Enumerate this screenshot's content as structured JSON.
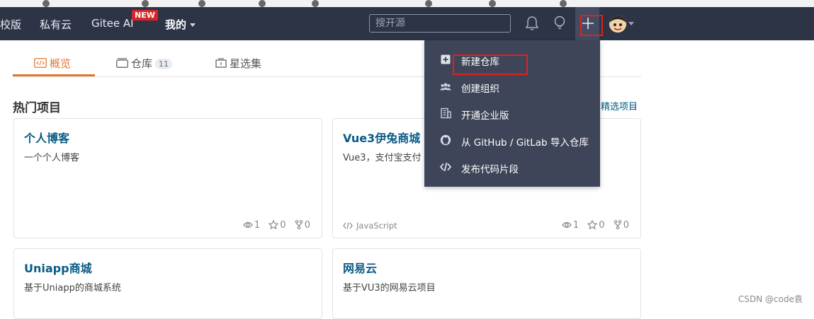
{
  "nav": {
    "items": [
      "校版",
      "私有云",
      "Gitee AI"
    ],
    "new_badge": "NEW",
    "mine": "我的",
    "search_placeholder": "搜开源"
  },
  "tabs": [
    {
      "label": "概览",
      "active": true
    },
    {
      "label": "仓库",
      "count": "11"
    },
    {
      "label": "星选集"
    }
  ],
  "section": {
    "title": "热门项目",
    "link": "精选项目"
  },
  "cards": [
    {
      "title": "个人博客",
      "desc": "一个个人博客",
      "lang": "",
      "watch": "1",
      "star": "0",
      "fork": "0"
    },
    {
      "title": "Vue3伊兔商城（",
      "desc": "Vue3，支付宝支付",
      "lang": "JavaScript",
      "watch": "1",
      "star": "0",
      "fork": "0"
    },
    {
      "title": "Uniapp商城",
      "desc": "基于Uniapp的商城系统"
    },
    {
      "title": "网易云",
      "desc": "基于VU3的网易云项目"
    }
  ],
  "dropdown": {
    "items": [
      {
        "label": "新建仓库",
        "icon": "plus-square-icon"
      },
      {
        "label": "创建组织",
        "icon": "users-icon"
      },
      {
        "label": "开通企业版",
        "icon": "building-icon"
      },
      {
        "label": "从 GitHub / GitLab 导入仓库",
        "icon": "github-icon"
      },
      {
        "label": "发布代码片段",
        "icon": "code-icon"
      }
    ]
  },
  "watermark": "CSDN @code袁",
  "colors": {
    "navbar": "#2d3446",
    "dropdown": "#3e4558",
    "accent": "#e0772c",
    "link": "#0a5a86",
    "highlight": "#e02020"
  }
}
